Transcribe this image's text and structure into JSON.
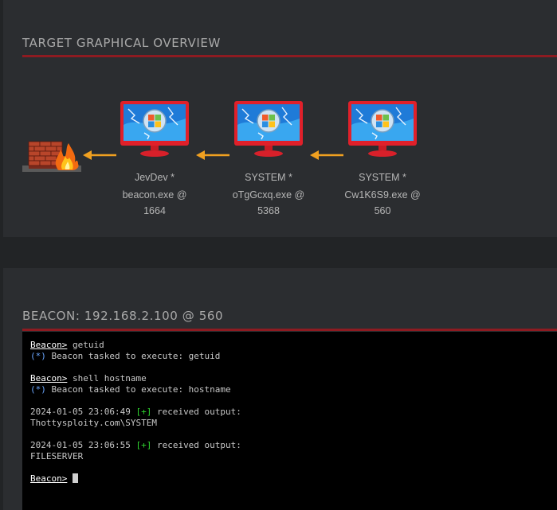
{
  "overview": {
    "title": "TARGET GRAPHICAL OVERVIEW",
    "nodes": [
      {
        "user": "JevDev *",
        "process": "beacon.exe @",
        "pid": "1664"
      },
      {
        "user": "SYSTEM *",
        "process": "oTgGcxq.exe @",
        "pid": "5368"
      },
      {
        "user": "SYSTEM *",
        "process": "Cw1K6S9.exe @",
        "pid": "560"
      }
    ],
    "colors": {
      "accent_red": "#8e1b21",
      "arrow": "#f0a020",
      "panel": "#2b2d30"
    }
  },
  "beacon": {
    "title": "BEACON: 192.168.2.100 @ 560",
    "console": {
      "l1_prompt": "Beacon>",
      "l1_cmd": " getuid",
      "l2_marker": "(*)",
      "l2_text": " Beacon tasked to execute: getuid",
      "l4_prompt": "Beacon>",
      "l4_cmd": " shell hostname",
      "l5_marker": "(*)",
      "l5_text": " Beacon tasked to execute: hostname",
      "l7_time": "2024-01-05 23:06:49 ",
      "l7_marker": "[+]",
      "l7_text": " received output:",
      "l8_text": "Thottysploity.com\\SYSTEM",
      "l10_time": "2024-01-05 23:06:55 ",
      "l10_marker": "[+]",
      "l10_text": " received output:",
      "l11_text": "FILESERVER",
      "l13_prompt": "Beacon>"
    }
  }
}
